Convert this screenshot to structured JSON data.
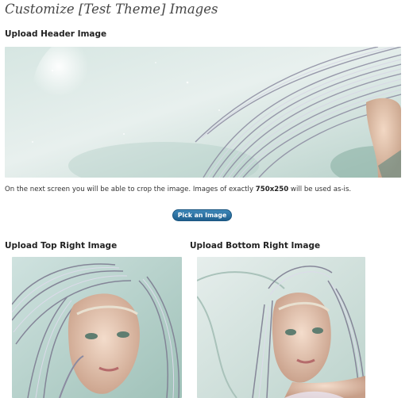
{
  "page": {
    "title": "Customize [Test Theme] Images"
  },
  "header_section": {
    "heading": "Upload Header Image",
    "help_prefix": "On the next screen you will be able to crop the image. Images of exactly ",
    "help_size": "750x250",
    "help_suffix": " will be used as-is.",
    "button_label": "Pick an Image",
    "image_icon": "fairy-header-image"
  },
  "top_right_section": {
    "heading": "Upload Top Right Image",
    "image_icon": "fairy-portrait-image"
  },
  "bottom_right_section": {
    "heading": "Upload Bottom Right Image",
    "image_icon": "fairy-portrait-image"
  },
  "colors": {
    "button_bg": "#21759b",
    "title_text": "#464646"
  }
}
